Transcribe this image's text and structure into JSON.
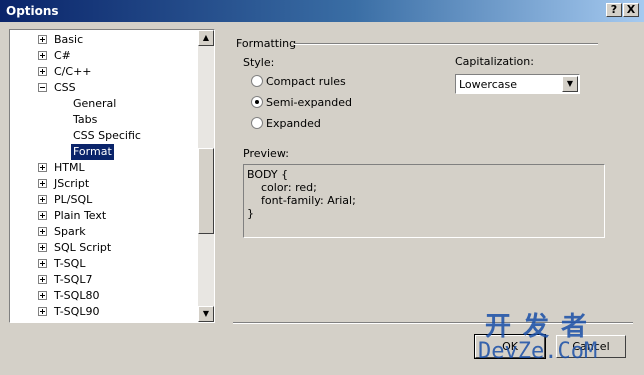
{
  "window": {
    "title": "Options",
    "help_glyph": "?",
    "close_glyph": "X"
  },
  "tree": {
    "items": [
      {
        "label": "Basic",
        "level": 0,
        "expander": "plus"
      },
      {
        "label": "C#",
        "level": 0,
        "expander": "plus"
      },
      {
        "label": "C/C++",
        "level": 0,
        "expander": "plus"
      },
      {
        "label": "CSS",
        "level": 0,
        "expander": "minus"
      },
      {
        "label": "General",
        "level": 1
      },
      {
        "label": "Tabs",
        "level": 1
      },
      {
        "label": "CSS Specific",
        "level": 1
      },
      {
        "label": "Format",
        "level": 1,
        "selected": true
      },
      {
        "label": "HTML",
        "level": 0,
        "expander": "plus"
      },
      {
        "label": "JScript",
        "level": 0,
        "expander": "plus"
      },
      {
        "label": "PL/SQL",
        "level": 0,
        "expander": "plus"
      },
      {
        "label": "Plain Text",
        "level": 0,
        "expander": "plus"
      },
      {
        "label": "Spark",
        "level": 0,
        "expander": "plus"
      },
      {
        "label": "SQL Script",
        "level": 0,
        "expander": "plus"
      },
      {
        "label": "T-SQL",
        "level": 0,
        "expander": "plus"
      },
      {
        "label": "T-SQL7",
        "level": 0,
        "expander": "plus"
      },
      {
        "label": "T-SQL80",
        "level": 0,
        "expander": "plus"
      },
      {
        "label": "T-SQL90",
        "level": 0,
        "expander": "plus"
      }
    ],
    "scroll_up": "▲",
    "scroll_down": "▼"
  },
  "formatting": {
    "group_label": "Formatting",
    "style_label": "Style:",
    "options": [
      {
        "label": "Compact rules",
        "checked": false
      },
      {
        "label": "Semi-expanded",
        "checked": true
      },
      {
        "label": "Expanded",
        "checked": false
      }
    ],
    "capitalization_label": "Capitalization:",
    "capitalization_value": "Lowercase",
    "dropdown_arrow": "▼",
    "preview_label": "Preview:",
    "preview_lines": [
      "BODY {",
      "    color: red;",
      "    font-family: Arial;",
      "}"
    ]
  },
  "buttons": {
    "ok": "OK",
    "cancel": "Cancel"
  },
  "watermark": {
    "line1": "开发者",
    "line2": "DevZe.CoM"
  }
}
